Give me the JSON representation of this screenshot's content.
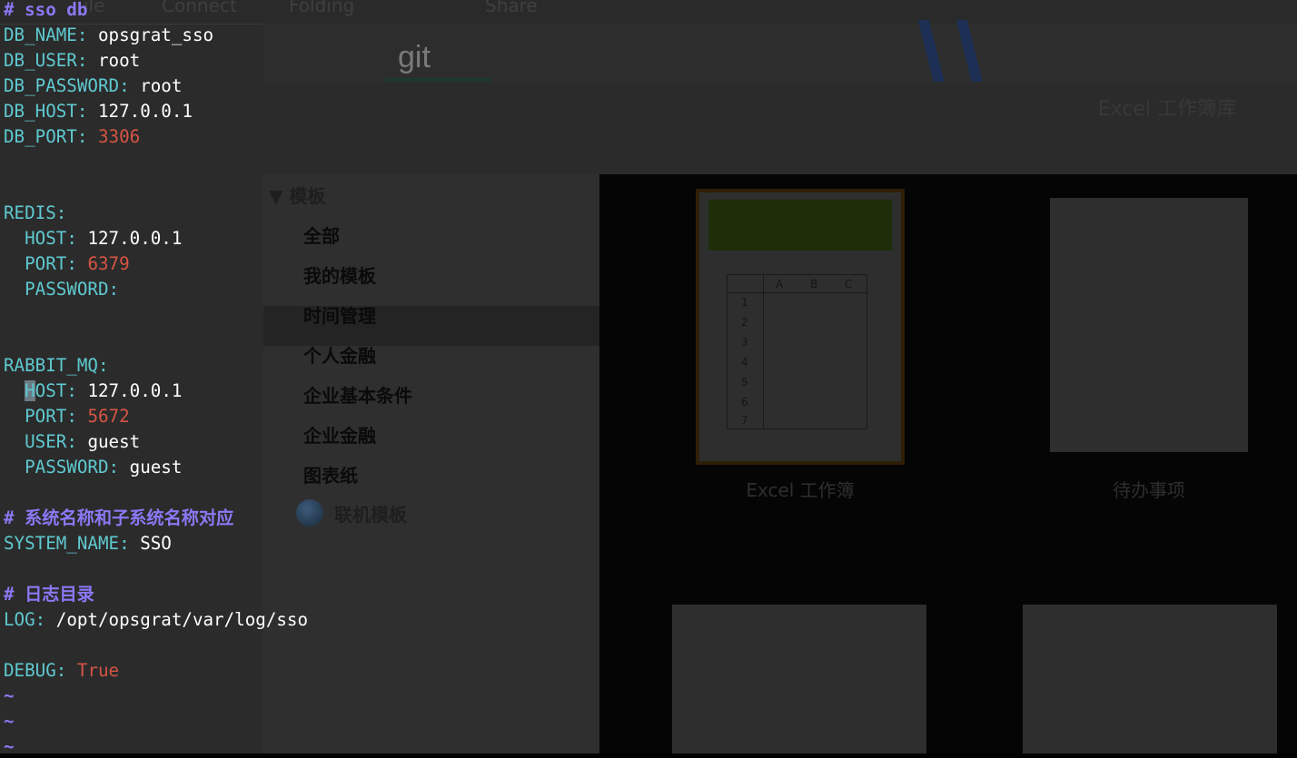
{
  "background_app": {
    "menu": [
      "ile",
      "Connect",
      "Folding",
      "Share"
    ],
    "tab_label": "git"
  },
  "dialog": {
    "title": "Excel 工作簿库",
    "sidebar": {
      "section_label": "模板",
      "items": [
        "全部",
        "我的模板",
        "时间管理",
        "个人金融",
        "企业基本条件",
        "企业金融",
        "图表纸"
      ],
      "selected_item": "全部",
      "online_label": "联机模板"
    },
    "templates": [
      {
        "caption": "Excel 工作簿"
      },
      {
        "caption": "待办事项"
      }
    ],
    "sheet": {
      "columns": [
        "A",
        "B",
        "C"
      ],
      "rows": [
        "1",
        "2",
        "3",
        "4",
        "5",
        "6",
        "7"
      ]
    }
  },
  "terminal": {
    "lines": [
      {
        "key": "# sso db",
        "type": "comment"
      },
      {
        "key": "DB_NAME",
        "value": "opsgrat_sso",
        "vtype": "str"
      },
      {
        "key": "DB_USER",
        "value": "root",
        "vtype": "str"
      },
      {
        "key": "DB_PASSWORD",
        "value": "root",
        "vtype": "str"
      },
      {
        "key": "DB_HOST",
        "value": "127.0.0.1",
        "vtype": "str"
      },
      {
        "key": "DB_PORT",
        "value": "3306",
        "vtype": "num"
      },
      {
        "blank": true
      },
      {
        "blank": true
      },
      {
        "key": "REDIS",
        "value": "",
        "vtype": "section"
      },
      {
        "key": "  HOST",
        "value": "127.0.0.1",
        "vtype": "str"
      },
      {
        "key": "  PORT",
        "value": "6379",
        "vtype": "num"
      },
      {
        "key": "  PASSWORD",
        "value": "",
        "vtype": "str"
      },
      {
        "blank": true
      },
      {
        "blank": true
      },
      {
        "key": "RABBIT_MQ",
        "value": "",
        "vtype": "section"
      },
      {
        "key": "  HOST",
        "value": "127.0.0.1",
        "vtype": "str",
        "cursor": true
      },
      {
        "key": "  PORT",
        "value": "5672",
        "vtype": "num"
      },
      {
        "key": "  USER",
        "value": "guest",
        "vtype": "str"
      },
      {
        "key": "  PASSWORD",
        "value": "guest",
        "vtype": "str"
      },
      {
        "blank": true
      },
      {
        "key": "# 系统名称和子系统名称对应",
        "type": "comment"
      },
      {
        "key": "SYSTEM_NAME",
        "value": "SSO",
        "vtype": "str"
      },
      {
        "blank": true
      },
      {
        "key": "# 日志目录",
        "type": "comment"
      },
      {
        "key": "LOG",
        "value": "/opt/opsgrat/var/log/sso",
        "vtype": "str"
      },
      {
        "blank": true
      },
      {
        "key": "DEBUG",
        "value": "True",
        "vtype": "num"
      },
      {
        "key": "~",
        "type": "tilde"
      },
      {
        "key": "~",
        "type": "tilde"
      },
      {
        "key": "~",
        "type": "tilde"
      }
    ]
  },
  "colors": {
    "key": "#5fc9d0",
    "value": "#ffffff",
    "number": "#d65544",
    "comment": "#8a79f5"
  }
}
